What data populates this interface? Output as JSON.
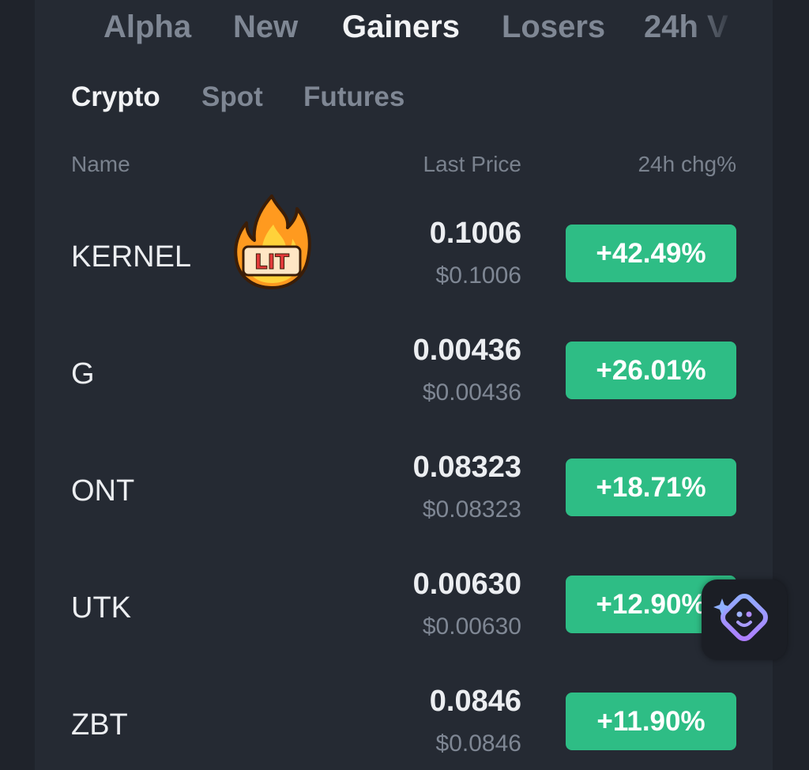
{
  "top_tabs": [
    {
      "label": "Alpha",
      "active": false
    },
    {
      "label": "New",
      "active": false
    },
    {
      "label": "Gainers",
      "active": true
    },
    {
      "label": "Losers",
      "active": false
    },
    {
      "label": "24h V",
      "active": false
    }
  ],
  "sub_tabs": [
    {
      "label": "Crypto",
      "active": true
    },
    {
      "label": "Spot",
      "active": false
    },
    {
      "label": "Futures",
      "active": false
    }
  ],
  "columns": {
    "name": "Name",
    "last_price": "Last Price",
    "change": "24h chg%"
  },
  "rows": [
    {
      "name": "KERNEL",
      "price": "0.1006",
      "price_usd": "$0.1006",
      "change": "+42.49%"
    },
    {
      "name": "G",
      "price": "0.00436",
      "price_usd": "$0.00436",
      "change": "+26.01%"
    },
    {
      "name": "ONT",
      "price": "0.08323",
      "price_usd": "$0.08323",
      "change": "+18.71%"
    },
    {
      "name": "UTK",
      "price": "0.00630",
      "price_usd": "$0.00630",
      "change": "+12.90%"
    },
    {
      "name": "ZBT",
      "price": "0.0846",
      "price_usd": "$0.0846",
      "change": "+11.90%"
    }
  ],
  "sticker": {
    "label": "LIT",
    "icon": "fire-icon"
  },
  "assistant": {
    "icon": "ai-assistant-icon"
  },
  "colors": {
    "background": "#252a33",
    "gain": "#2ebd85",
    "text_primary": "#eceef1",
    "text_secondary": "#7f8794"
  }
}
